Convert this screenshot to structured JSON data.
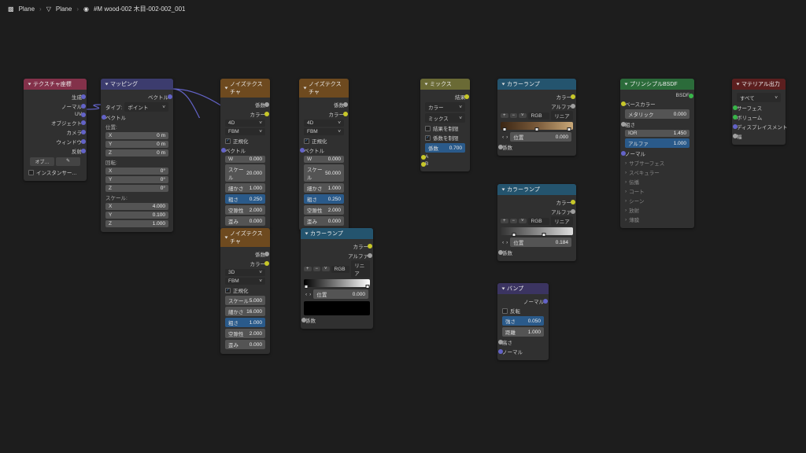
{
  "breadcrumb": {
    "i1": "Plane",
    "i2": "Plane",
    "i3": "#M wood-002 木目-002-002_001"
  },
  "nodes": {
    "texcoord": {
      "title": "テクスチャ座標",
      "outs": [
        "生成",
        "ノーマル",
        "UV",
        "オブジェクト",
        "カメラ",
        "ウィンドウ",
        "反射"
      ],
      "obj": "オブ…",
      "inst": "インスタンサー…"
    },
    "mapping": {
      "title": "マッピング",
      "out": "ベクトル",
      "type_lbl": "タイプ:",
      "type_val": "ポイント",
      "vec_in": "ベクトル",
      "loc": "位置:",
      "rot": "回転:",
      "scl": "スケール:",
      "loc_vals": {
        "x": "0 m",
        "y": "0 m",
        "z": "0 m"
      },
      "rot_vals": {
        "x": "0°",
        "y": "0°",
        "z": "0°"
      },
      "scl_vals": {
        "x": "4.000",
        "y": "0.100",
        "z": "1.000"
      }
    },
    "noise1": {
      "title": "ノイズテクスチャ",
      "out_fac": "係数",
      "out_col": "カラー",
      "dim": "4D",
      "noise": "FBM",
      "norm": "正規化",
      "vec": "ベクトル",
      "fields": [
        {
          "k": "W",
          "v": "0.000"
        },
        {
          "k": "スケール",
          "v": "20.000"
        },
        {
          "k": "細かさ",
          "v": "1.000"
        },
        {
          "k": "粗さ",
          "v": "0.250",
          "blue": true
        },
        {
          "k": "空隙性",
          "v": "2.000"
        },
        {
          "k": "歪み",
          "v": "0.000"
        }
      ]
    },
    "noise2": {
      "title": "ノイズテクスチャ",
      "out_fac": "係数",
      "out_col": "カラー",
      "dim": "4D",
      "noise": "FBM",
      "norm": "正規化",
      "vec": "ベクトル",
      "fields": [
        {
          "k": "W",
          "v": "0.000"
        },
        {
          "k": "スケール",
          "v": "50.000"
        },
        {
          "k": "細かさ",
          "v": "1.000"
        },
        {
          "k": "粗さ",
          "v": "0.250",
          "blue": true
        },
        {
          "k": "空隙性",
          "v": "2.000"
        },
        {
          "k": "歪み",
          "v": "0.000"
        }
      ]
    },
    "noise3": {
      "title": "ノイズテクスチャ",
      "out_fac": "係数",
      "out_col": "カラー",
      "dim": "3D",
      "noise": "FBM",
      "norm": "正規化",
      "fields": [
        {
          "k": "スケール",
          "v": "5.000"
        },
        {
          "k": "細かさ",
          "v": "16.000"
        },
        {
          "k": "粗さ",
          "v": "1.000",
          "blue": true
        },
        {
          "k": "空隙性",
          "v": "2.000"
        },
        {
          "k": "歪み",
          "v": "0.000"
        }
      ]
    },
    "mix": {
      "title": "ミックス",
      "out": "結果",
      "data": "カラー",
      "blend": "ミックス",
      "clamp_result": "結果を制限",
      "clamp_factor": "係数を制限",
      "fac_lbl": "係数",
      "fac": "0.700",
      "a": "A",
      "b": "B"
    },
    "colramp1": {
      "title": "カラーランプ",
      "out_col": "カラー",
      "out_a": "アルファ",
      "mode1": "RGB",
      "mode2": "リニア",
      "pos_lbl": "位置",
      "pos": "0.000",
      "fac": "係数"
    },
    "colramp2": {
      "title": "カラーランプ",
      "out_col": "カラー",
      "out_a": "アルファ",
      "mode1": "RGB",
      "mode2": "リニア",
      "pos_lbl": "位置",
      "pos": "0.184",
      "fac": "係数"
    },
    "colramp3": {
      "title": "カラーランプ",
      "out_col": "カラー",
      "out_a": "アルファ",
      "mode1": "RGB",
      "mode2": "リニア",
      "pos_lbl": "位置",
      "pos": "0.000",
      "fac": "係数"
    },
    "bump": {
      "title": "バンプ",
      "out": "ノーマル",
      "invert": "反転",
      "strength_lbl": "強さ",
      "strength": "0.050",
      "dist_lbl": "距離",
      "dist": "1.000",
      "height": "高さ",
      "normal": "ノーマル"
    },
    "bsdf": {
      "title": "プリンシプルBSDF",
      "out": "BSDF",
      "base": "ベースカラー",
      "metal_lbl": "メタリック",
      "metal": "0.000",
      "rough_lbl": "粗さ",
      "ior_lbl": "IOR",
      "ior": "1.450",
      "alpha_lbl": "アルファ",
      "alpha": "1.000",
      "normal": "ノーマル",
      "subs": "サブサーフェス",
      "spec": "スペキュラー",
      "trans": "伝播",
      "coat": "コート",
      "sheen": "シーン",
      "emit": "放射",
      "film": "薄膜"
    },
    "output": {
      "title": "マテリアル出力",
      "target": "すべて",
      "surf": "サーフェス",
      "vol": "ボリューム",
      "disp": "ディスプレイスメント",
      "thick": "幅"
    }
  }
}
